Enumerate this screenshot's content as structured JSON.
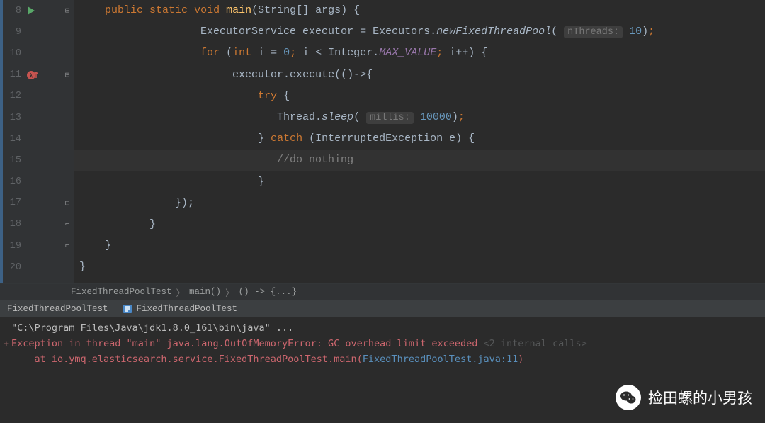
{
  "lines": {
    "8": "8",
    "9": "9",
    "10": "10",
    "11": "11",
    "12": "12",
    "13": "13",
    "14": "14",
    "15": "15",
    "16": "16",
    "17": "17",
    "18": "18",
    "19": "19",
    "20": "20"
  },
  "code": {
    "l8": {
      "kw_public": "public",
      "kw_static": "static",
      "kw_void": "void",
      "m": "main",
      "sig": "(String[] args) {"
    },
    "l9": {
      "a": "ExecutorService executor = Executors.",
      "m": "newFixedThreadPool",
      "hint": "nThreads:",
      "n": "10",
      "p": "(",
      "tail": ")",
      "semi": ";"
    },
    "l10": {
      "kw_for": "for",
      "p1": "(",
      "kw_int": "int",
      "iv": "i = ",
      "zero": "0",
      "semi1": ";",
      "cmp": " i < Integer.",
      "mv": "MAX_VALUE",
      "semi2": ";",
      "inc": " i++) {"
    },
    "l11": {
      "a": "executor.execute(()->{"
    },
    "l12": {
      "kw_try": "try",
      "b": " {"
    },
    "l13": {
      "a": "Thread.",
      "m": "sleep",
      "p": "(",
      "hint": "millis:",
      "n": "10000",
      "tail": ")",
      "semi": ";"
    },
    "l14": {
      "b": "} ",
      "kw_catch": "catch",
      "p": " (InterruptedException e) {"
    },
    "l15": {
      "c": "//do nothing"
    },
    "l16": {
      "b": "}"
    },
    "l17": {
      "b": "});"
    },
    "l18": {
      "b": "}"
    },
    "l19": {
      "b": "}"
    },
    "l20": {
      "b": "}"
    }
  },
  "breadcrumb": {
    "a": "FixedThreadPoolTest",
    "b": "main()",
    "c": "() -> {...}"
  },
  "tabs": {
    "t1": "FixedThreadPoolTest",
    "t2": "FixedThreadPoolTest"
  },
  "console": {
    "l1": "\"C:\\Program Files\\Java\\jdk1.8.0_161\\bin\\java\" ...",
    "l2a": "Exception in thread \"main\" java.lang.OutOfMemoryError: GC overhead limit exceeded",
    "l2b": " <2 internal calls>",
    "l3a": "    at io.ymq.elasticsearch.service.FixedThreadPoolTest.main(",
    "l3b": "FixedThreadPoolTest.java:11",
    "l3c": ")",
    "plus": "+"
  },
  "watermark": {
    "text": "捡田螺的小男孩"
  }
}
